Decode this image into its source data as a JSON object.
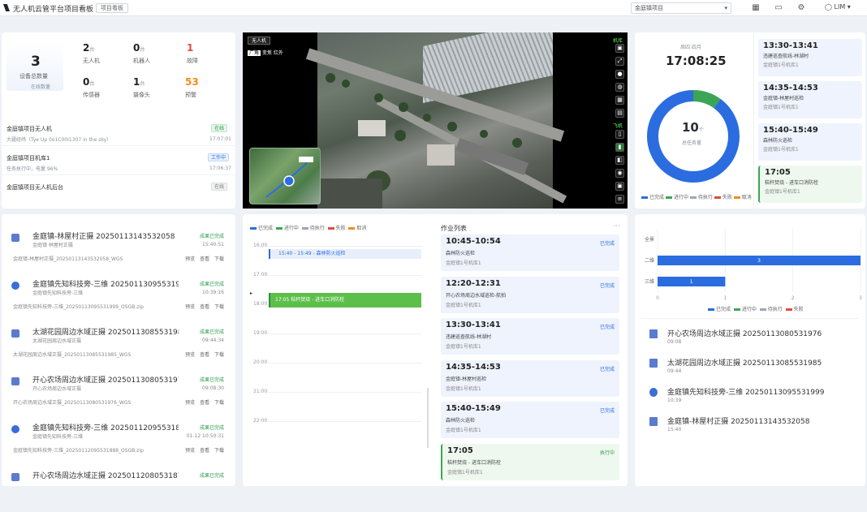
{
  "header": {
    "title": "无人机云管平台项目看板",
    "version": "项目看板",
    "project_select": "金庭镇项目",
    "user": "LIM"
  },
  "stats": {
    "device_total": {
      "value": "3",
      "label": "设备总数量",
      "sub": "在线数量"
    },
    "items": [
      {
        "value": "2",
        "unit": "台",
        "label": "无人机"
      },
      {
        "value": "0",
        "unit": "台",
        "label": "机器人"
      },
      {
        "value": "1",
        "unit": "",
        "label": "故障",
        "color": "#e04b3f"
      },
      {
        "value": "0",
        "unit": "台",
        "label": "传感器"
      },
      {
        "value": "1",
        "unit": "台",
        "label": "摄像头"
      },
      {
        "value": "53",
        "unit": "",
        "label": "预警",
        "color": "#f08c1c"
      }
    ]
  },
  "device_list": [
    {
      "name": "金庭镇项目无人机",
      "detail": "大疆经纬（Tye Up 0o1C00I1307 in the sky）",
      "status": "在线",
      "time": "17:07:01",
      "tag": "green"
    },
    {
      "name": "金庭镇项目机库1",
      "detail": "任务执行中，电量 96%",
      "status": "工作中",
      "time": "17:06:37",
      "tag": "blue"
    },
    {
      "name": "金庭镇项目无人机后台",
      "detail": "",
      "status": "在线",
      "time": "",
      "tag": "gray"
    }
  ],
  "video": {
    "tab": "无人机",
    "modes": [
      "广角",
      "变焦",
      "红外"
    ],
    "tool_group1": "机库",
    "tool_group2": "飞机"
  },
  "clock": {
    "date": "周四 四月",
    "time": "17:08:25",
    "donut_value": "10",
    "donut_unit": "个",
    "donut_label": "总任务量",
    "legend": [
      "已完成",
      "进行中",
      "待执行",
      "失败",
      "取消"
    ]
  },
  "schedule_right": [
    {
      "time": "13:30-13:41",
      "title": "违建巡查航线-林湖村",
      "unit": "金庭镇1号机库1"
    },
    {
      "time": "14:35-14:53",
      "title": "金庭镇-林屋村巡检",
      "unit": "金庭镇1号机库1"
    },
    {
      "time": "15:40-15:49",
      "title": "森林防火巡检",
      "unit": "金庭镇1号机库1"
    },
    {
      "time": "17:05",
      "title": "秸秆焚烧 - 进车口消防栓",
      "unit": "金庭镇1号机库1",
      "active": true
    }
  ],
  "files": [
    {
      "title": "金庭镇-林屋村正摄 20250113143532058",
      "sub": "金庭镇 林屋村正摄",
      "status": "成果已完成",
      "time": "15:40:51",
      "path": "金庭镇-林屋村正摄_20250113143532058_WGS",
      "actions": "预览 查看 下载",
      "icon": "square"
    },
    {
      "title": "金庭镇先知科技旁-三维 20250113095531999",
      "sub": "金庭镇先知科技旁-三维",
      "status": "成果已完成",
      "time": "10:39:16",
      "path": "金庭镇先知科技旁-三维_20250113095531999_OSGB.zip",
      "actions": "预览 查看 下载",
      "icon": "round"
    },
    {
      "title": "太湖花园周边水域正摄 20250113085531985",
      "sub": "太湖花园周边水域正摄",
      "status": "成果已完成",
      "time": "09:44:34",
      "path": "太湖花园周边水域正摄_20250113085531985_WGS",
      "actions": "预览 查看 下载",
      "icon": "square"
    },
    {
      "title": "开心农场周边水域正摄 20250113080531976",
      "sub": "开心农场周边水域正摄",
      "status": "成果已完成",
      "time": "09:08:30",
      "path": "开心农场周边水域正摄_20250113080531976_WGS",
      "actions": "预览 查看 下载",
      "icon": "square"
    },
    {
      "title": "金庭镇先知科技旁-三维 20250112095531888",
      "sub": "金庭镇先知科技旁-三维",
      "status": "成果已完成",
      "time": "01-12 10:50:31",
      "path": "金庭镇先知科技旁-三维_20250112095531888_OSGB.zip",
      "actions": "预览 查看 下载",
      "icon": "round"
    },
    {
      "title": "开心农场周边水域正摄 20250112080531872",
      "sub": "",
      "status": "成果已完成",
      "time": "",
      "path": "",
      "actions": "",
      "icon": "square"
    }
  ],
  "timeline": {
    "legend": [
      "已完成",
      "进行中",
      "待执行",
      "失败",
      "取消"
    ],
    "hours": [
      "16:00",
      "17:00",
      "18:00",
      "19:00",
      "20:00",
      "21:00",
      "22:00"
    ],
    "events": [
      {
        "label": "15:40 - 15:49 - 森林防火巡检"
      },
      {
        "label": "17:05 秸秆焚烧 - 进车口消防栓"
      }
    ]
  },
  "tasks": {
    "title": "作业列表",
    "more": "···",
    "items": [
      {
        "time": "10:45-10:54",
        "title": "森林防火巡检",
        "unit": "金庭镇1号机库1",
        "status": "已完成"
      },
      {
        "time": "12:20-12:31",
        "title": "开心农场周边水域巡检-航拍",
        "unit": "金庭镇1号机库1",
        "status": "已完成"
      },
      {
        "time": "13:30-13:41",
        "title": "违建巡查航线-林湖村",
        "unit": "金庭镇1号机库1",
        "status": "已完成"
      },
      {
        "time": "14:35-14:53",
        "title": "金庭镇-林屋村巡检",
        "unit": "金庭镇1号机库1",
        "status": "已完成"
      },
      {
        "time": "15:40-15:49",
        "title": "森林防火巡检",
        "unit": "金庭镇1号机库1",
        "status": "已完成"
      },
      {
        "time": "17:05",
        "title": "秸秆焚烧 - 进车口消防栓",
        "unit": "金庭镇1号机库1",
        "status": "执行中",
        "active": true
      }
    ]
  },
  "chart_data": {
    "type": "bar",
    "orientation": "horizontal",
    "categories": [
      "全景",
      "二维",
      "三维"
    ],
    "values": [
      0,
      3,
      1
    ],
    "xlim": [
      0,
      3
    ],
    "xticks": [
      "0",
      "1",
      "2",
      "3"
    ],
    "legend": [
      "已完成",
      "进行中",
      "待执行",
      "失败"
    ]
  },
  "right_files": [
    {
      "name": "开心农场周边水域正摄 20250113080531976",
      "date": "09:08"
    },
    {
      "name": "太湖花园周边水域正摄 20250113085531985",
      "date": "09:44"
    },
    {
      "name": "金庭镇先知科技旁-三维 20250113095531999",
      "date": "10:39"
    },
    {
      "name": "金庭镇-林屋村正摄 20250113143532058",
      "date": "15:40"
    }
  ],
  "colors": {
    "accent": "#2b6de0",
    "success": "#3aa655",
    "danger": "#e04b3f",
    "warning": "#f08c1c",
    "panel": "#ffffff",
    "bg": "#eef1f6"
  }
}
